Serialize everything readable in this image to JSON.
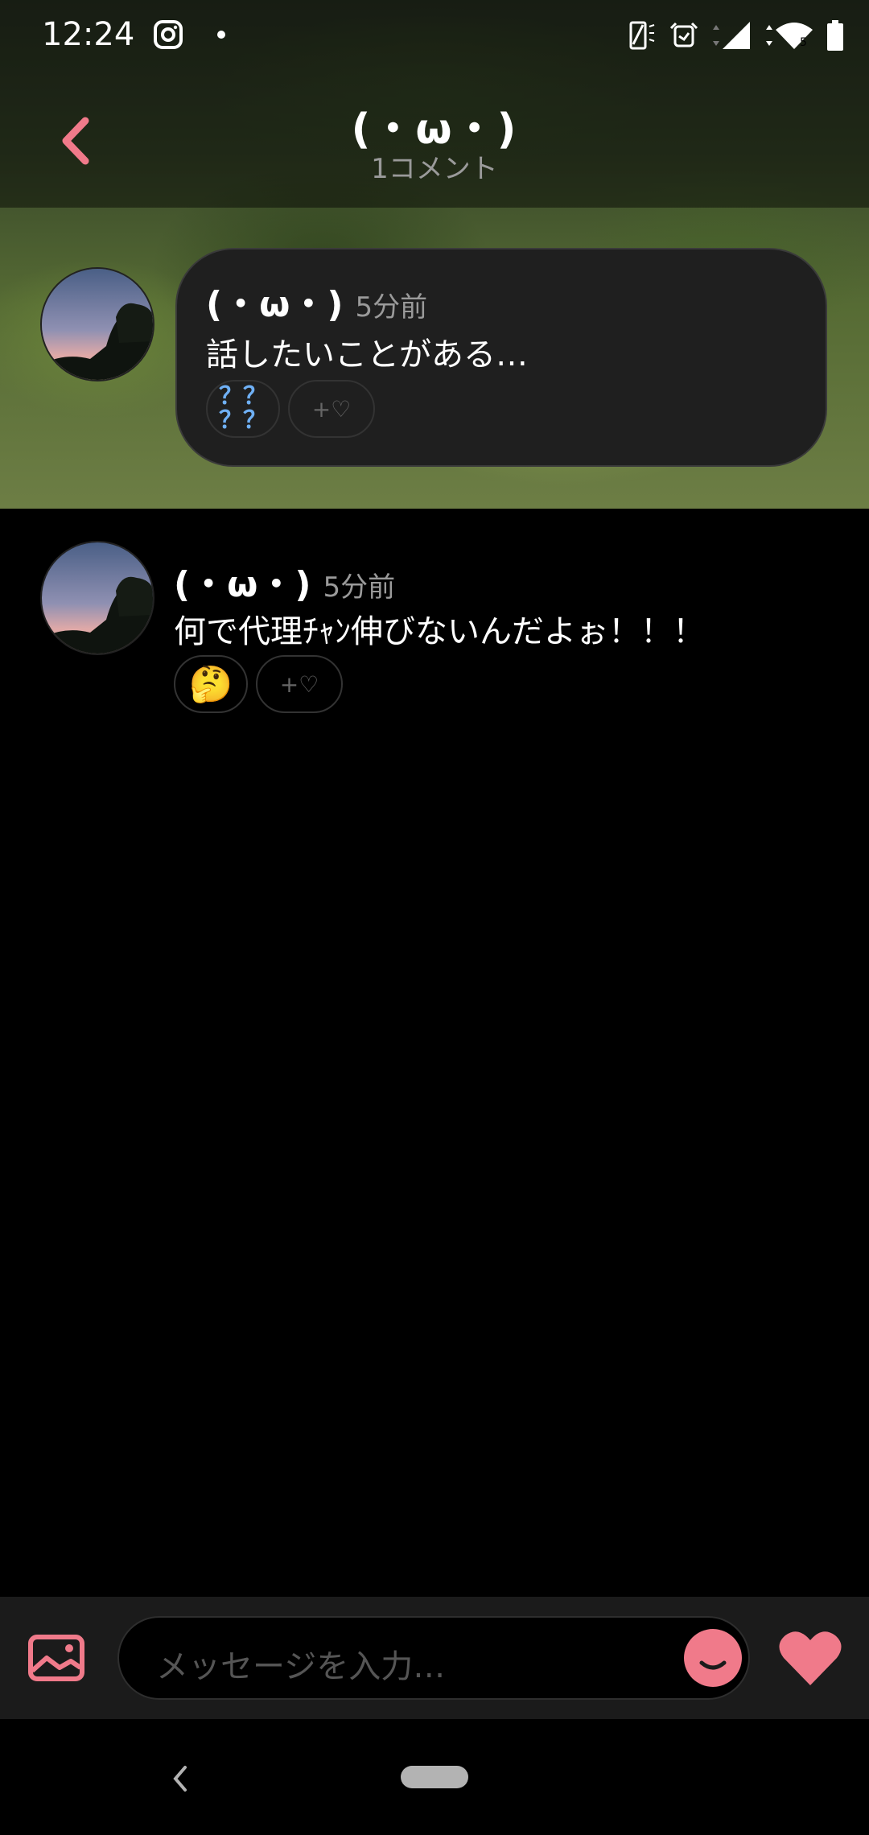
{
  "status_bar": {
    "time": "12:24",
    "icons": [
      "instagram-icon",
      "notification-dot-icon",
      "vibrate-icon",
      "alarm-icon",
      "signal-icon",
      "wifi-icon",
      "battery-icon"
    ],
    "wifi_badge": "5"
  },
  "header": {
    "title": "(・ω・)",
    "subtitle": "1コメント",
    "back_icon": "chevron-left-icon",
    "accent": "#f07a8a"
  },
  "post": {
    "author": "(・ω・)",
    "time": "5分前",
    "body": "話したいことがある…",
    "reaction": "？？\n？？",
    "add_reaction_label": "+♡"
  },
  "comments": [
    {
      "author": "(・ω・)",
      "time": "5分前",
      "body": "何で代理ﾁｬﾝ伸びないんだよぉ！！！",
      "reaction": "🤔",
      "add_reaction_label": "+♡"
    }
  ],
  "input_bar": {
    "placeholder": "メッセージを入力…",
    "image_icon": "image-icon",
    "emoji_icon": "smiley-icon",
    "like_icon": "heart-icon"
  },
  "nav_bar": {
    "back_icon": "nav-back-icon",
    "home_icon": "home-pill-icon"
  }
}
